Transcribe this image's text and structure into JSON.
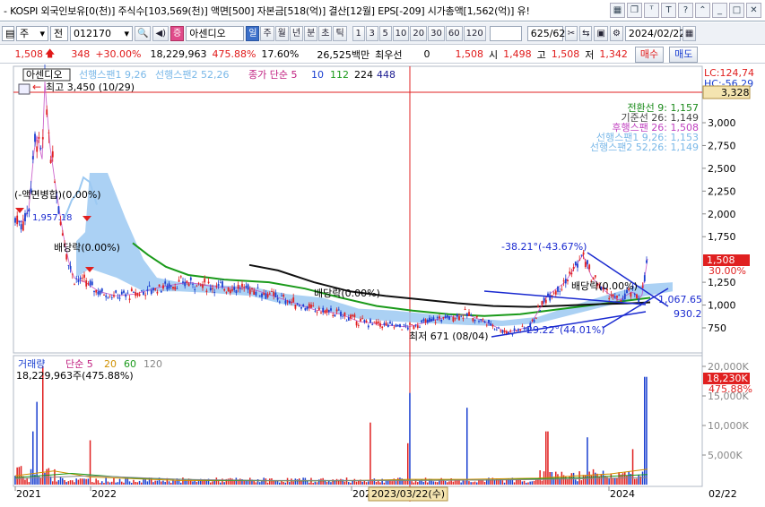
{
  "infobar": {
    "text": "- KOSPI  외국인보유[0(천)]  주식수[103,569(천)]  액면[500]  자본금[518(억)]  결산[12월]  EPS[-209]  시가총액[1,562(억)]  유!",
    "tool_icons": [
      "grid-icon",
      "restore-icon",
      "pin-icon",
      "text-icon",
      "help-icon",
      "chevron-up-icon",
      "minimize-icon",
      "maximize-icon",
      "close-icon"
    ],
    "tool_glyphs": [
      "▦",
      "❐",
      "ᵀ",
      "T",
      "?",
      "⌃",
      "_",
      "□",
      "✕"
    ]
  },
  "toolbar": {
    "period": "주",
    "market": "전",
    "code": "012170",
    "name_badge": "증",
    "name": "아센디오",
    "periods": [
      "일",
      "주",
      "월",
      "년",
      "분",
      "초",
      "틱"
    ],
    "active_period": "일",
    "intervals": [
      "1",
      "3",
      "5",
      "10",
      "20",
      "30",
      "60",
      "120"
    ],
    "count": "625/625",
    "date": "2024/02/22"
  },
  "quote": {
    "price": "1,508",
    "change": "348",
    "pct": "+30.00%",
    "volume": "18,229,963",
    "vol_pct": "475.88%",
    "turnover": "17.60%",
    "amount": "26,525백만",
    "best_label": "최우선",
    "best": "0",
    "open_val": "1,508",
    "open_label": "시",
    "open": "1,498",
    "high_label": "고",
    "high": "1,508",
    "low_label": "저",
    "low": "1,342",
    "buy": "매수",
    "sell": "매도"
  },
  "chart": {
    "legend_stock": "아센디오",
    "legend_ichimoku": [
      "선행스팬1 9,26",
      "선행스팬2 52,26"
    ],
    "legend_ma_title": "종가 단순 5",
    "legend_ma": [
      "10",
      "112",
      "224",
      "448"
    ],
    "max_label": "최고 3,450 (10/29)",
    "min_label": "최저 671 (08/04)",
    "ichimoku_values": [
      {
        "label": "전환선 9: 1,157",
        "color": "#1a8a1a"
      },
      {
        "label": "기준선 26: 1,149",
        "color": "#444444"
      },
      {
        "label": "후행스팬 26: 1,508",
        "color": "#c040c0"
      },
      {
        "label": "선행스팬1 9,26: 1,153",
        "color": "#7ab8e8"
      },
      {
        "label": "선행스팬2 52,26: 1,149",
        "color": "#7ab8e8"
      }
    ],
    "lc": "LC:124,74",
    "hc": "HC:-56,29",
    "price_box": "3,328",
    "current_price": "1,508",
    "current_pct": "30.00%",
    "y_ticks": [
      "3,000",
      "2,750",
      "2,500",
      "2,250",
      "2,000",
      "1,750",
      "1,250",
      "1,000",
      "750"
    ],
    "annotations": {
      "merge": "(-액면병합)(0.00%)",
      "p1957": "1,957.18",
      "div1": "배당락(0.00%)",
      "div2": "배당락(0.00%)",
      "div3": "배당락(0.00%)",
      "angle1": "-38.21°(-43.67%)",
      "angle2": "29.22°(44.01%)",
      "tri1": "1,067.65",
      "tri2": "930.2"
    },
    "volume_title": "거래량",
    "volume_ma_title": "단순 5",
    "volume_ma": [
      {
        "label": "20",
        "color": "#d09000"
      },
      {
        "label": "60",
        "color": "#1a9a1a"
      },
      {
        "label": "120",
        "color": "#888888"
      }
    ],
    "volume_value": "18,229,963주(475.88%)",
    "vol_ticks": [
      "20,000K",
      "15,000K",
      "10,000K",
      "5,000K"
    ],
    "vol_current": "18,230K",
    "vol_current_pct": "475.88%",
    "x_labels": [
      "2021",
      "2022",
      "202",
      "2024"
    ],
    "crosshair_date": "2023/03/22(수)",
    "right_date": "02/22"
  }
}
